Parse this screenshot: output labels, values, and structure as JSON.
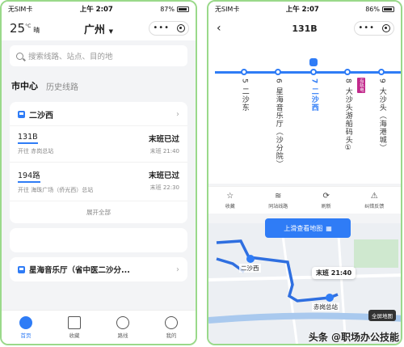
{
  "left": {
    "status": {
      "carrier": "无SIM卡",
      "time": "上午 2:07",
      "battery": "87%"
    },
    "header": {
      "temp": "25",
      "temp_unit": "°C",
      "weather": "晴",
      "city": "广州"
    },
    "search": {
      "placeholder": "搜索线路、站点、目的地"
    },
    "tabs": [
      {
        "label": "市中心"
      },
      {
        "label": "历史线路"
      }
    ],
    "card1": {
      "title": "二沙西",
      "routes": [
        {
          "name": "131B",
          "direction": "开往 赤岗总站",
          "status": "末班已过",
          "last_time": "末班 21:40"
        },
        {
          "name": "194路",
          "direction": "开往 海珠广场（侨光西）总站",
          "status": "末班已过",
          "last_time": "末班 22:30"
        }
      ],
      "expand": "展开全部"
    },
    "card2": {
      "title": "星海音乐厅（省中医二沙分..."
    },
    "nav": [
      {
        "label": "首页"
      },
      {
        "label": "收藏"
      },
      {
        "label": "路线"
      },
      {
        "label": "我的"
      }
    ]
  },
  "right": {
    "status": {
      "carrier": "无SIM卡",
      "time": "上午 2:07",
      "battery": "86%"
    },
    "header": {
      "title": "131B"
    },
    "stops": [
      {
        "num": "5",
        "name": "二沙东"
      },
      {
        "num": "6",
        "name": "星海音乐厅（沙分院）"
      },
      {
        "num": "7",
        "name": "二沙西"
      },
      {
        "num": "8",
        "name": "大沙头游船码头①"
      },
      {
        "num": "9",
        "name": "大沙头（海港城）"
      }
    ],
    "metro_tag": "有轨电",
    "actions": [
      {
        "label": "收藏"
      },
      {
        "label": "同站线路"
      },
      {
        "label": "刷新"
      },
      {
        "label": "纠错反馈"
      }
    ],
    "map": {
      "slide": "上滑查看地图",
      "stop_label": "二沙西",
      "tooltip": "末班 21:40",
      "terminal": "赤岗总站",
      "full": "全屏地图"
    }
  },
  "watermark": "头条 @职场办公技能"
}
